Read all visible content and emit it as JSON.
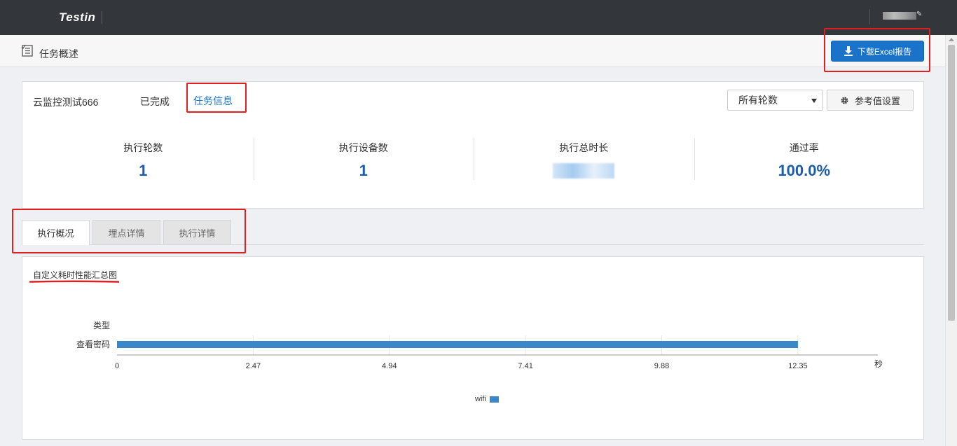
{
  "app": {
    "logo": "Testin"
  },
  "header": {
    "title": "任务概述",
    "download_label": "下载Excel报告"
  },
  "task": {
    "name": "云监控测试666",
    "status": "已完成",
    "info_link": "任务信息",
    "rounds_selected": "所有轮数",
    "ref_button_label": "参考值设置"
  },
  "stats": [
    {
      "label": "执行轮数",
      "value": "1"
    },
    {
      "label": "执行设备数",
      "value": "1"
    },
    {
      "label": "执行总时长",
      "value": ""
    },
    {
      "label": "通过率",
      "value": "100.0%"
    }
  ],
  "tabs": [
    {
      "label": "执行概况",
      "active": true
    },
    {
      "label": "埋点详情",
      "active": false
    },
    {
      "label": "执行详情",
      "active": false
    }
  ],
  "chart_data": {
    "type": "bar",
    "orientation": "horizontal",
    "title": "自定义耗时性能汇总图",
    "ylabel": "类型",
    "xlabel": "",
    "x_unit": "秒",
    "categories": [
      "查看密码"
    ],
    "series": [
      {
        "name": "wifi",
        "values": [
          12.35
        ],
        "color": "#3a87c9"
      }
    ],
    "xticks": [
      0,
      2.47,
      4.94,
      7.41,
      9.88,
      12.35
    ],
    "xlim": [
      0,
      13.8
    ],
    "grid": true,
    "legend": "bottom"
  },
  "colors": {
    "accent": "#1a73c9",
    "topbar": "#33373b",
    "highlight": "#e02020"
  }
}
